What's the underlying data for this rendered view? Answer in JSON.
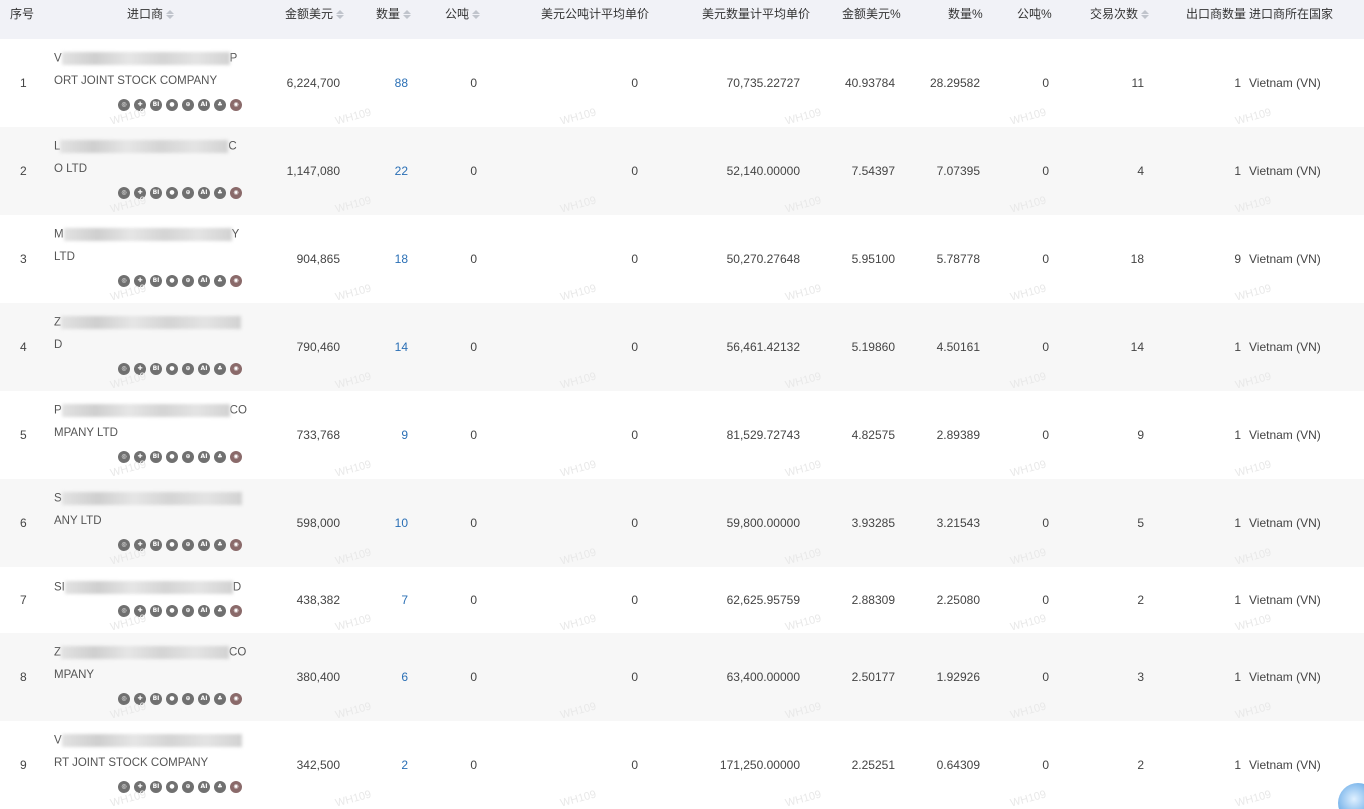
{
  "columns": [
    {
      "key": "index",
      "label": "序号",
      "sortable": false
    },
    {
      "key": "importer",
      "label": "进口商",
      "sortable": true
    },
    {
      "key": "amount_usd",
      "label": "金额美元",
      "sortable": true
    },
    {
      "key": "quantity",
      "label": "数量",
      "sortable": true
    },
    {
      "key": "metric_ton",
      "label": "公吨",
      "sortable": true
    },
    {
      "key": "usd_per_ton",
      "label": "美元公吨计平均单价",
      "sortable": false
    },
    {
      "key": "usd_per_qty",
      "label": "美元数量计平均单价",
      "sortable": false
    },
    {
      "key": "amount_pct",
      "label": "金额美元%",
      "sortable": false
    },
    {
      "key": "qty_pct",
      "label": "数量%",
      "sortable": false
    },
    {
      "key": "ton_pct",
      "label": "公吨%",
      "sortable": false
    },
    {
      "key": "trades",
      "label": "交易次数",
      "sortable": true
    },
    {
      "key": "exporters",
      "label": "出口商数量",
      "sortable": false
    },
    {
      "key": "country",
      "label": "进口商所在国家",
      "sortable": false
    }
  ],
  "icon_names": [
    "target-icon",
    "plus-circle-icon",
    "bi-icon",
    "chat-icon",
    "globe-icon",
    "ai-icon",
    "people-icon",
    "contact-icon"
  ],
  "icon_glyphs": [
    "◎",
    "✚",
    "BI",
    "●",
    "⊕",
    "AI",
    "♣",
    "◉"
  ],
  "watermark": "WH109",
  "rows": [
    {
      "index": "1",
      "line1_prefix": "V",
      "line1_suffix": "P",
      "line2": "ORT JOINT STOCK COMPANY",
      "amount_usd": "6,224,700",
      "quantity": "88",
      "metric_ton": "0",
      "usd_per_ton": "0",
      "usd_per_qty": "70,735.22727",
      "amount_pct": "40.93784",
      "qty_pct": "28.29582",
      "ton_pct": "0",
      "trades": "11",
      "exporters": "1",
      "country": "Vietnam (VN)"
    },
    {
      "index": "2",
      "line1_prefix": "L",
      "line1_suffix": "C",
      "line2": "O LTD",
      "amount_usd": "1,147,080",
      "quantity": "22",
      "metric_ton": "0",
      "usd_per_ton": "0",
      "usd_per_qty": "52,140.00000",
      "amount_pct": "7.54397",
      "qty_pct": "7.07395",
      "ton_pct": "0",
      "trades": "4",
      "exporters": "1",
      "country": "Vietnam (VN)"
    },
    {
      "index": "3",
      "line1_prefix": "M",
      "line1_suffix": "Y",
      "line2": "LTD",
      "amount_usd": "904,865",
      "quantity": "18",
      "metric_ton": "0",
      "usd_per_ton": "0",
      "usd_per_qty": "50,270.27648",
      "amount_pct": "5.95100",
      "qty_pct": "5.78778",
      "ton_pct": "0",
      "trades": "18",
      "exporters": "9",
      "country": "Vietnam (VN)"
    },
    {
      "index": "4",
      "line1_prefix": "Z",
      "line1_suffix": "",
      "line2": "D",
      "amount_usd": "790,460",
      "quantity": "14",
      "metric_ton": "0",
      "usd_per_ton": "0",
      "usd_per_qty": "56,461.42132",
      "amount_pct": "5.19860",
      "qty_pct": "4.50161",
      "ton_pct": "0",
      "trades": "14",
      "exporters": "1",
      "country": "Vietnam (VN)"
    },
    {
      "index": "5",
      "line1_prefix": "P",
      "line1_suffix": "CO",
      "line2": "MPANY LTD",
      "amount_usd": "733,768",
      "quantity": "9",
      "metric_ton": "0",
      "usd_per_ton": "0",
      "usd_per_qty": "81,529.72743",
      "amount_pct": "4.82575",
      "qty_pct": "2.89389",
      "ton_pct": "0",
      "trades": "9",
      "exporters": "1",
      "country": "Vietnam (VN)"
    },
    {
      "index": "6",
      "line1_prefix": "S",
      "line1_suffix": "",
      "line2": "ANY LTD",
      "amount_usd": "598,000",
      "quantity": "10",
      "metric_ton": "0",
      "usd_per_ton": "0",
      "usd_per_qty": "59,800.00000",
      "amount_pct": "3.93285",
      "qty_pct": "3.21543",
      "ton_pct": "0",
      "trades": "5",
      "exporters": "1",
      "country": "Vietnam (VN)"
    },
    {
      "index": "7",
      "line1_prefix": "SI",
      "line1_suffix": "D",
      "line2": "",
      "amount_usd": "438,382",
      "quantity": "7",
      "metric_ton": "0",
      "usd_per_ton": "0",
      "usd_per_qty": "62,625.95759",
      "amount_pct": "2.88309",
      "qty_pct": "2.25080",
      "ton_pct": "0",
      "trades": "2",
      "exporters": "1",
      "country": "Vietnam (VN)"
    },
    {
      "index": "8",
      "line1_prefix": "Z",
      "line1_suffix": "CO",
      "line2": "MPANY",
      "amount_usd": "380,400",
      "quantity": "6",
      "metric_ton": "0",
      "usd_per_ton": "0",
      "usd_per_qty": "63,400.00000",
      "amount_pct": "2.50177",
      "qty_pct": "1.92926",
      "ton_pct": "0",
      "trades": "3",
      "exporters": "1",
      "country": "Vietnam (VN)"
    },
    {
      "index": "9",
      "line1_prefix": "V",
      "line1_suffix": "",
      "line2": "RT JOINT STOCK COMPANY",
      "amount_usd": "342,500",
      "quantity": "2",
      "metric_ton": "0",
      "usd_per_ton": "0",
      "usd_per_qty": "171,250.00000",
      "amount_pct": "2.25251",
      "qty_pct": "0.64309",
      "ton_pct": "0",
      "trades": "2",
      "exporters": "1",
      "country": "Vietnam (VN)"
    }
  ]
}
